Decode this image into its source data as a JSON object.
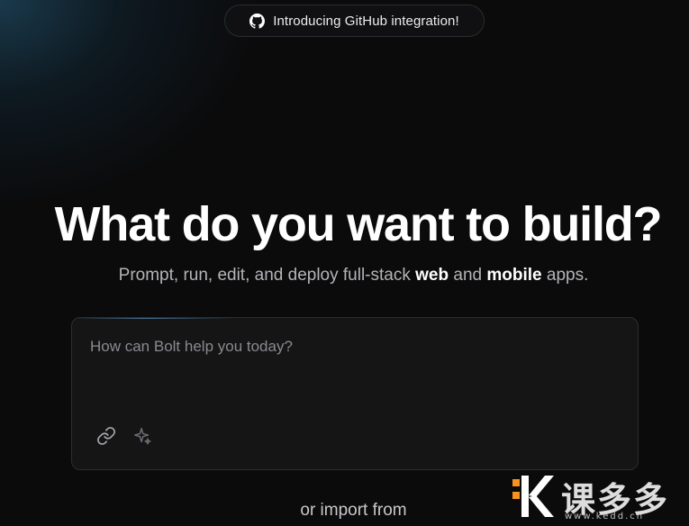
{
  "announcement": {
    "label": "Introducing GitHub integration!",
    "icon": "github-icon"
  },
  "hero": {
    "title": "What do you want to build?",
    "subtitle_prefix": "Prompt, run, edit, and deploy full-stack ",
    "subtitle_bold_1": "web",
    "subtitle_middle": " and ",
    "subtitle_bold_2": "mobile",
    "subtitle_suffix": " apps."
  },
  "prompt": {
    "placeholder": "How can Bolt help you today?",
    "value": "",
    "attach_icon": "link-icon",
    "enhance_icon": "sparkles-icon"
  },
  "import": {
    "label": "or import from"
  },
  "watermark": {
    "text": "课多多",
    "url": "www.kedd.cn"
  },
  "colors": {
    "background": "#0b0b0c",
    "accent_glow": "#266080",
    "watermark_orange": "#f7931e"
  }
}
